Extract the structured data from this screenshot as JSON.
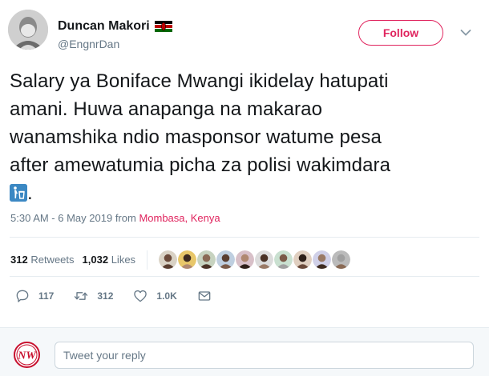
{
  "tweet": {
    "display_name": "Duncan Makori",
    "handle": "@EngnrDan",
    "flag_icon": "kenya-flag-icon",
    "text_lines": [
      "Salary ya Boniface Mwangi ikidelay hatupati",
      "amani. Huwa anapanga na makarao",
      "wanamshika ndio masponsor watume pesa",
      "after amewatumia picha za polisi wakimdara"
    ],
    "trailing_emoji": "litter-in-bin-emoji",
    "trailing_punct": ".",
    "timestamp": "5:30 AM - 6 May 2019",
    "from_label": "from",
    "location": "Mombasa, Kenya"
  },
  "follow_button": {
    "label": "Follow"
  },
  "stats": {
    "retweets_count": "312",
    "retweets_label": "Retweets",
    "likes_count": "1,032",
    "likes_label": "Likes",
    "liker_avatar_count": 10
  },
  "actions": {
    "reply_count": "117",
    "retweet_count": "312",
    "like_count": "1.0K"
  },
  "reply_box": {
    "placeholder": "Tweet your reply",
    "logo_text": "NW"
  },
  "colors": {
    "accent_red": "#e0245e",
    "muted_text": "#657786",
    "body_text": "#14171a",
    "divider": "#e6ecf0"
  }
}
